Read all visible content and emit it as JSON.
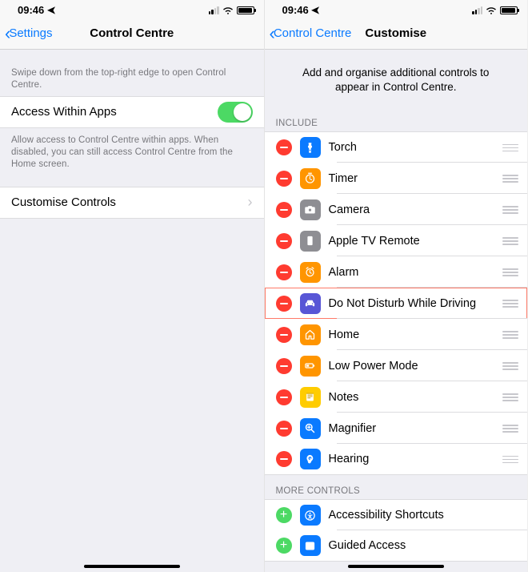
{
  "status": {
    "time": "09:46"
  },
  "left": {
    "back": "Settings",
    "title": "Control Centre",
    "hint": "Swipe down from the top-right edge to open Control Centre.",
    "toggle_label": "Access Within Apps",
    "toggle_on": true,
    "toggle_footer": "Allow access to Control Centre within apps. When disabled, you can still access Control Centre from the Home screen.",
    "customise_label": "Customise Controls"
  },
  "right": {
    "back": "Control Centre",
    "title": "Customise",
    "intro": "Add and organise additional controls to appear in Control Centre.",
    "include_header": "INCLUDE",
    "more_header": "MORE CONTROLS",
    "include": [
      {
        "label": "Torch",
        "icon": "torch",
        "color": "#0a7aff"
      },
      {
        "label": "Timer",
        "icon": "timer",
        "color": "#ff9500"
      },
      {
        "label": "Camera",
        "icon": "camera",
        "color": "#8e8e93"
      },
      {
        "label": "Apple TV Remote",
        "icon": "remote",
        "color": "#8e8e93"
      },
      {
        "label": "Alarm",
        "icon": "alarm",
        "color": "#ff9500"
      },
      {
        "label": "Do Not Disturb While Driving",
        "icon": "car",
        "color": "#5856d6",
        "highlight": true
      },
      {
        "label": "Home",
        "icon": "home",
        "color": "#ff9500"
      },
      {
        "label": "Low Power Mode",
        "icon": "battery",
        "color": "#ff9500"
      },
      {
        "label": "Notes",
        "icon": "notes",
        "color": "#ffcc00"
      },
      {
        "label": "Magnifier",
        "icon": "magnifier",
        "color": "#0a7aff"
      },
      {
        "label": "Hearing",
        "icon": "ear",
        "color": "#0a7aff"
      }
    ],
    "more": [
      {
        "label": "Accessibility Shortcuts",
        "icon": "accessibility",
        "color": "#0a7aff"
      },
      {
        "label": "Guided Access",
        "icon": "lock",
        "color": "#0a7aff"
      }
    ]
  }
}
